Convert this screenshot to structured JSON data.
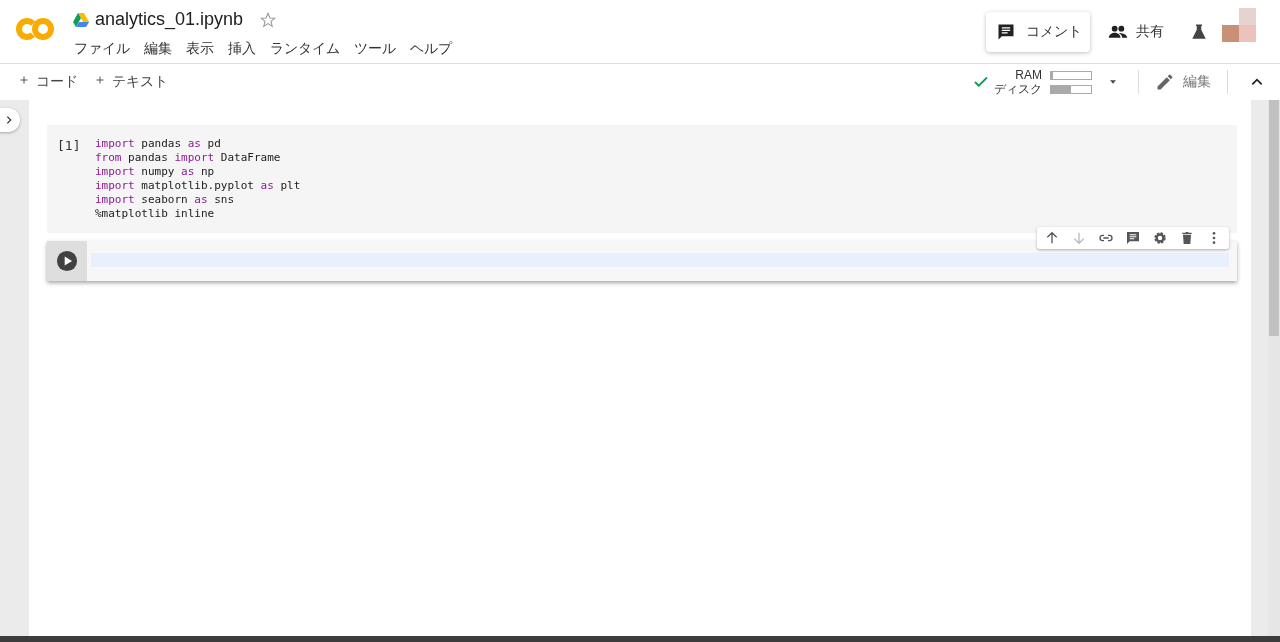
{
  "header": {
    "title": "analytics_01.ipynb",
    "starred": false,
    "menu": [
      "ファイル",
      "編集",
      "表示",
      "挿入",
      "ランタイム",
      "ツール",
      "ヘルプ"
    ],
    "comment_button": "コメント",
    "share_button": "共有"
  },
  "toolbar": {
    "add_buttons": [
      "コード",
      "テキスト"
    ],
    "connected": true,
    "meters": [
      {
        "label": "RAM",
        "level": 0.05
      },
      {
        "label": "ディスク",
        "level": 0.5
      }
    ],
    "edit_button": "編集"
  },
  "cells": [
    {
      "kind": "code",
      "count": "[1]",
      "focused": false,
      "lines": [
        [
          {
            "text": "import",
            "kind": "keyword"
          },
          {
            "text": " pandas ",
            "kind": "plain"
          },
          {
            "text": "as",
            "kind": "keyword"
          },
          {
            "text": " pd",
            "kind": "plain"
          }
        ],
        [
          {
            "text": "from",
            "kind": "keyword"
          },
          {
            "text": " pandas ",
            "kind": "plain"
          },
          {
            "text": "import",
            "kind": "keyword"
          },
          {
            "text": " DataFrame",
            "kind": "plain"
          }
        ],
        [
          {
            "text": "import",
            "kind": "keyword"
          },
          {
            "text": " numpy ",
            "kind": "plain"
          },
          {
            "text": "as",
            "kind": "keyword"
          },
          {
            "text": " np",
            "kind": "plain"
          }
        ],
        [
          {
            "text": "import",
            "kind": "keyword"
          },
          {
            "text": " matplotlib.pyplot ",
            "kind": "plain"
          },
          {
            "text": "as",
            "kind": "keyword"
          },
          {
            "text": " plt",
            "kind": "plain"
          }
        ],
        [
          {
            "text": "import",
            "kind": "keyword"
          },
          {
            "text": " seaborn ",
            "kind": "plain"
          },
          {
            "text": "as",
            "kind": "keyword"
          },
          {
            "text": " sns",
            "kind": "plain"
          }
        ],
        [
          {
            "text": "%matplotlib inline",
            "kind": "plain"
          }
        ]
      ]
    },
    {
      "kind": "code",
      "focused": true,
      "cell_toolbar": [
        {
          "kind": "up",
          "disabled": false
        },
        {
          "kind": "down",
          "disabled": true
        },
        {
          "kind": "link",
          "disabled": false
        },
        {
          "kind": "comment",
          "disabled": false
        },
        {
          "kind": "settings",
          "disabled": false
        },
        {
          "kind": "delete",
          "disabled": false
        },
        {
          "kind": "more",
          "disabled": false
        }
      ]
    }
  ]
}
